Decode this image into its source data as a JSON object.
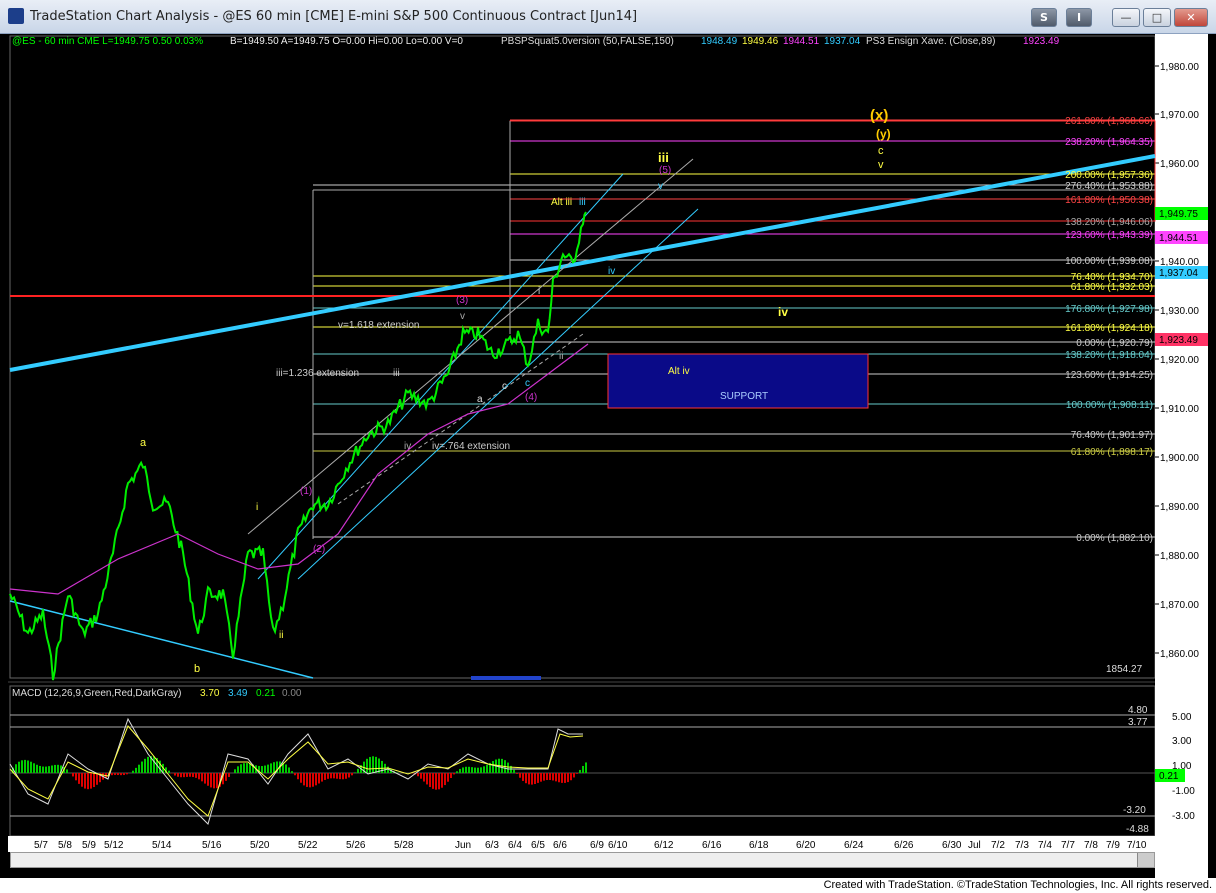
{
  "window": {
    "title": "TradeStation Chart Analysis - @ES 60 min [CME] E-mini S&P 500 Continuous Contract [Jun14]",
    "buttons": [
      "S",
      "I",
      "—",
      "□",
      "✕"
    ]
  },
  "header": {
    "symbol": "@ES - 60 min  CME  L=1949.75  0.50  0.03%",
    "bid_ask": "B=1949.50   A=1949.75  O=0.00  Hi=0.00  Lo=0.00  V=0",
    "indicator": "PBSPSquat5.0version (50,FALSE,150)",
    "ind_vals": [
      "1948.49",
      "1949.46",
      "1944.51",
      "1937.04"
    ],
    "ensign": "PS3 Ensign Xave. (Close,89)",
    "ensign_val": "1923.49"
  },
  "price_axis": [
    "1,980.00",
    "1,970.00",
    "1,960.00",
    "1,950.00",
    "1,940.00",
    "1,930.00",
    "1,920.00",
    "1,910.00",
    "1,900.00",
    "1,890.00",
    "1,880.00",
    "1,870.00",
    "1,860.00"
  ],
  "price_tags": [
    {
      "text": "1,949.75",
      "color": "#00ff00"
    },
    {
      "text": "1,944.51",
      "color": "#ff44ff"
    },
    {
      "text": "1,937.04",
      "color": "#33ccff"
    },
    {
      "text": "1,923.49",
      "color": "#ff3366"
    }
  ],
  "fib_levels": [
    {
      "text": "261.80% (1,968.66)",
      "color": "#ff4444"
    },
    {
      "text": "238.20% (1,964.35)",
      "color": "#ff44ff"
    },
    {
      "text": "200.00% (1,957.36)",
      "color": "#ffff44"
    },
    {
      "text": "276.40% (1,953.88)",
      "color": "#cccccc"
    },
    {
      "text": "161.80% (1,950.38)",
      "color": "#ff4444"
    },
    {
      "text": "138.20% (1,946.06)",
      "color": "#aaaaaa"
    },
    {
      "text": "123.60% (1,943.39)",
      "color": "#ff44ff"
    },
    {
      "text": "100.00% (1,939.08)",
      "color": "#cccccc"
    },
    {
      "text": "76.40% (1,934.70)",
      "color": "#ffff44"
    },
    {
      "text": "61.80% (1,932.03)",
      "color": "#ffff44"
    },
    {
      "text": "176.80% (1,927.98)",
      "color": "#66cccc"
    },
    {
      "text": "161.80% (1,924.18)",
      "color": "#ffff44"
    },
    {
      "text": "0.00% (1,920.79)",
      "color": "#cccccc"
    },
    {
      "text": "138.20% (1,918.04)",
      "color": "#66cccc"
    },
    {
      "text": "123.60% (1,914.25)",
      "color": "#cccccc"
    },
    {
      "text": "100.00% (1,908.11)",
      "color": "#66cccc"
    },
    {
      "text": "76.40% (1,901.97)",
      "color": "#cccccc"
    },
    {
      "text": "61.80% (1,898.17)",
      "color": "#cccc44"
    },
    {
      "text": "0.00% (1,882.10)",
      "color": "#cccccc"
    }
  ],
  "low_value": "1854.27",
  "annotations": {
    "x_wave": "(x)",
    "y_wave": "(y)",
    "c_wave": "c",
    "v_wave": "v",
    "iii_wave": "iii",
    "five_wave": "(5)",
    "alt_iii": "Alt iii",
    "iii_small": "iii",
    "iv_small": "iv",
    "iv_big": "iv",
    "three_wave": "(3)",
    "v_ext": "v=1.618 extension",
    "iii_ext": "iii=1.236 extension",
    "iii_mid": "iii",
    "iv_ext": "iv=.764 extension",
    "four_wave": "(4)",
    "alt_iv": "Alt iv",
    "support": "SUPPORT",
    "a_top": "a",
    "b_bot": "b",
    "i_small": "i",
    "ii_small": "ii",
    "one_wave": "(1)",
    "two_wave": "(2)",
    "a_small": "a",
    "c_small": "c",
    "c2": "c",
    "ii_2": "ii",
    "iv_2": "iv",
    "v_2": "v",
    "i_2": "i",
    "v_3": "v"
  },
  "macd": {
    "label": "MACD (12,26,9,Green,Red,DarkGray)",
    "vals": [
      "3.70",
      "3.49",
      "0.21",
      "0.00"
    ],
    "axis": [
      "5.00",
      "3.00",
      "1.00",
      "-1.00",
      "-3.00"
    ],
    "refs": [
      "4.80",
      "3.77",
      "-3.20",
      "-4.88"
    ],
    "tag": "0.21"
  },
  "date_axis": [
    "5/7",
    "5/8",
    "5/9",
    "5/12",
    "5/14",
    "5/16",
    "5/20",
    "5/22",
    "5/26",
    "5/28",
    "Jun",
    "6/3",
    "6/4",
    "6/5",
    "6/6",
    "6/9",
    "6/10",
    "6/12",
    "6/16",
    "6/18",
    "6/20",
    "6/24",
    "6/26",
    "6/30",
    "Jul",
    "7/2",
    "7/3",
    "7/4",
    "7/7",
    "7/8",
    "7/9",
    "7/10"
  ],
  "footer": "Created with TradeStation. ©TradeStation Technologies, Inc. All rights reserved.",
  "colors": {
    "bars": "#00ee00",
    "trend": "#33ccff",
    "magenta": "#cc33cc",
    "fib_red": "#ff2222",
    "support": "#0a0a88"
  }
}
